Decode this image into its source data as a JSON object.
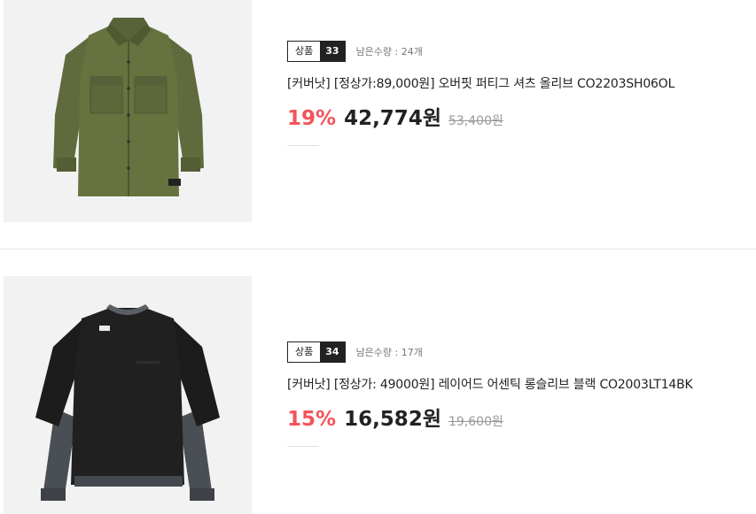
{
  "products": [
    {
      "badge_label": "상품",
      "badge_number": "33",
      "stock": "남은수량 : 24개",
      "title": "[커버낫] [정상가:89,000원] 오버핏 퍼티그 셔츠 올리브 CO2203SH06OL",
      "discount": "19%",
      "price": "42,774원",
      "original_price": "53,400원",
      "image": "olive-shirt-image"
    },
    {
      "badge_label": "상품",
      "badge_number": "34",
      "stock": "남은수량 : 17개",
      "title": "[커버낫] [정상가: 49000원] 레이어드 어센틱 롱슬리브 블랙 CO2003LT14BK",
      "discount": "15%",
      "price": "16,582원",
      "original_price": "19,600원",
      "image": "black-longsleeve-image"
    }
  ],
  "colors": {
    "discount": "#f2545b",
    "text": "#222222",
    "muted": "#999999",
    "thumb_bg": "#f2f2f2"
  }
}
